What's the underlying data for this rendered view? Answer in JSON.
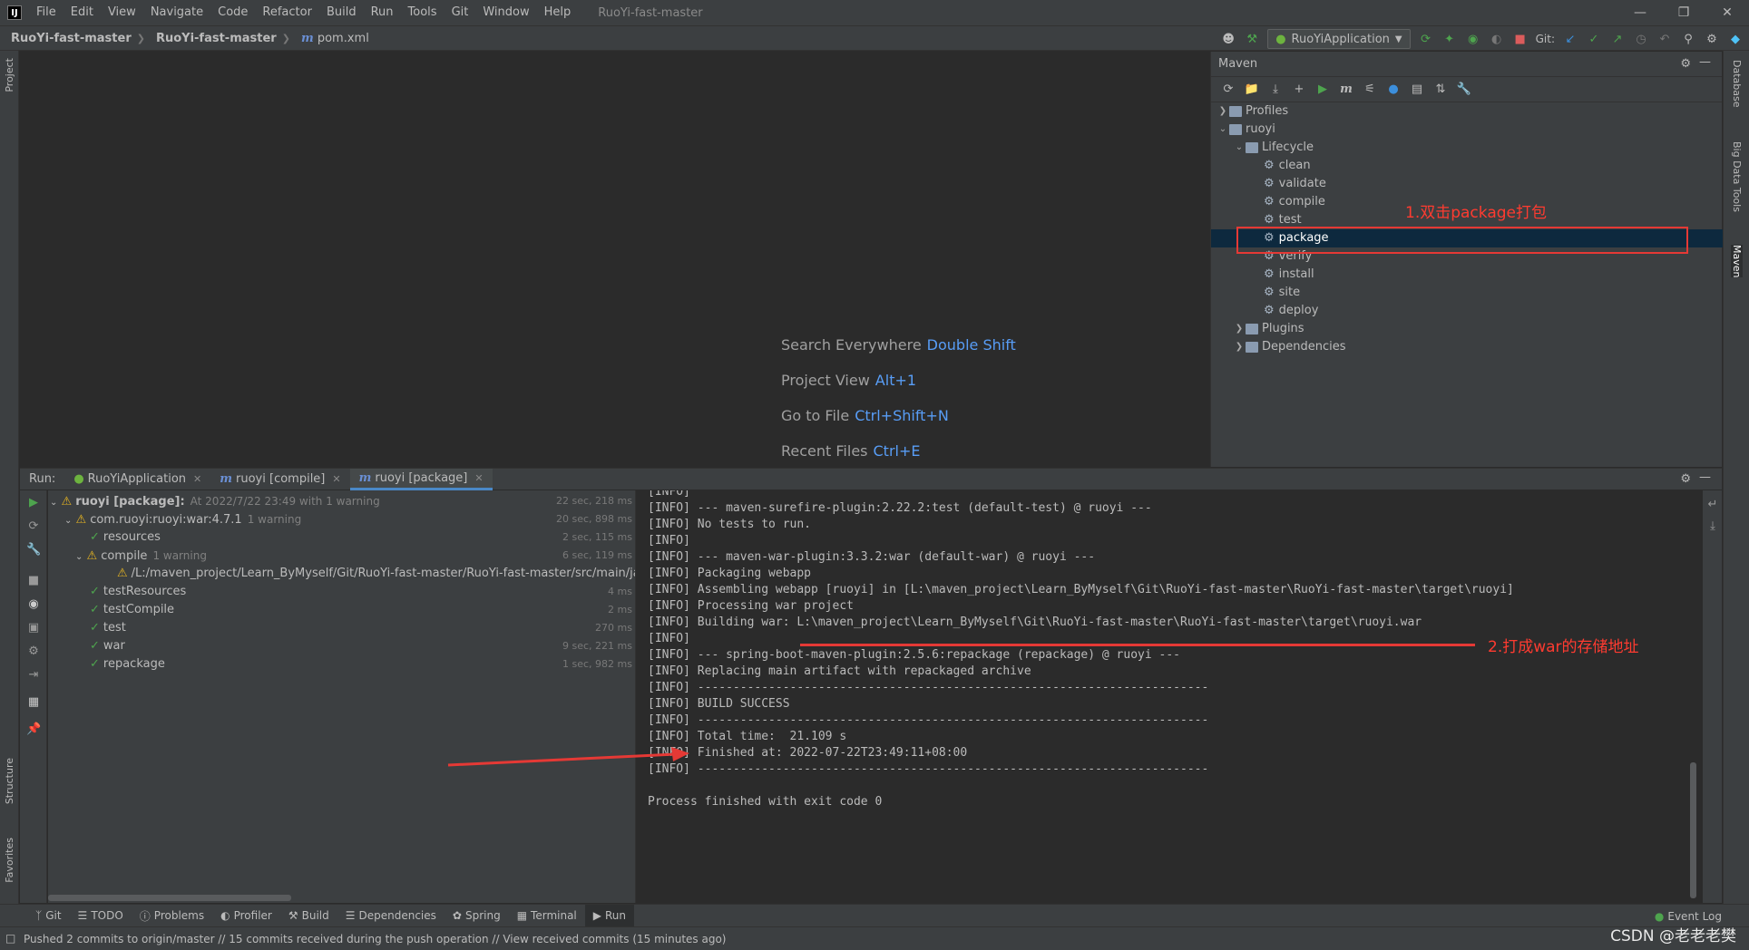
{
  "window": {
    "title": "RuoYi-fast-master",
    "menu": [
      "File",
      "Edit",
      "View",
      "Navigate",
      "Code",
      "Refactor",
      "Build",
      "Run",
      "Tools",
      "Git",
      "Window",
      "Help"
    ]
  },
  "breadcrumb": {
    "project": "RuoYi-fast-master",
    "module": "RuoYi-fast-master",
    "file": "pom.xml"
  },
  "toolbar": {
    "run_config": "RuoYiApplication",
    "git_label": "Git:"
  },
  "left_stripe": {
    "project": "Project",
    "structure": "Structure",
    "favorites": "Favorites"
  },
  "right_stripe": {
    "database": "Database",
    "big_data": "Big Data Tools",
    "maven": "Maven"
  },
  "editor_hints": [
    {
      "label": "Search Everywhere",
      "key": "Double Shift"
    },
    {
      "label": "Project View",
      "key": "Alt+1"
    },
    {
      "label": "Go to File",
      "key": "Ctrl+Shift+N"
    },
    {
      "label": "Recent Files",
      "key": "Ctrl+E"
    }
  ],
  "maven": {
    "title": "Maven",
    "profiles": "Profiles",
    "project": "ruoyi",
    "lifecycle": "Lifecycle",
    "phases": [
      "clean",
      "validate",
      "compile",
      "test",
      "package",
      "verify",
      "install",
      "site",
      "deploy"
    ],
    "plugins": "Plugins",
    "dependencies": "Dependencies",
    "annotation": "1.双击package打包"
  },
  "run": {
    "label": "Run:",
    "tabs": [
      {
        "label": "RuoYiApplication"
      },
      {
        "label": "ruoyi [compile]"
      },
      {
        "label": "ruoyi [package]"
      }
    ],
    "tree": [
      {
        "text": "ruoyi [package]:",
        "extra": "At 2022/7/22 23:49 with 1 warning",
        "time": "22 sec, 218 ms"
      },
      {
        "text": "com.ruoyi:ruoyi:war:4.7.1",
        "extra": "1 warning",
        "time": "20 sec, 898 ms"
      },
      {
        "text": "resources",
        "extra": "",
        "time": "2 sec, 115 ms"
      },
      {
        "text": "compile",
        "extra": "1 warning",
        "time": "6 sec, 119 ms"
      },
      {
        "text": "/L:/maven_project/Learn_ByMyself/Git/RuoYi-fast-master/RuoYi-fast-master/src/main/java/com/",
        "extra": "",
        "time": ""
      },
      {
        "text": "testResources",
        "extra": "",
        "time": "4 ms"
      },
      {
        "text": "testCompile",
        "extra": "",
        "time": "2 ms"
      },
      {
        "text": "test",
        "extra": "",
        "time": "270 ms"
      },
      {
        "text": "war",
        "extra": "",
        "time": "9 sec, 221 ms"
      },
      {
        "text": "repackage",
        "extra": "",
        "time": "1 sec, 982 ms"
      }
    ],
    "console": [
      "[INFO]",
      "[INFO] --- maven-surefire-plugin:2.22.2:test (default-test) @ ruoyi ---",
      "[INFO] No tests to run.",
      "[INFO]",
      "[INFO] --- maven-war-plugin:3.3.2:war (default-war) @ ruoyi ---",
      "[INFO] Packaging webapp",
      "[INFO] Assembling webapp [ruoyi] in [L:\\maven_project\\Learn_ByMyself\\Git\\RuoYi-fast-master\\RuoYi-fast-master\\target\\ruoyi]",
      "[INFO] Processing war project",
      "[INFO] Building war: L:\\maven_project\\Learn_ByMyself\\Git\\RuoYi-fast-master\\RuoYi-fast-master\\target\\ruoyi.war",
      "[INFO]",
      "[INFO] --- spring-boot-maven-plugin:2.5.6:repackage (repackage) @ ruoyi ---",
      "[INFO] Replacing main artifact with repackaged archive",
      "[INFO] ------------------------------------------------------------------------",
      "[INFO] BUILD SUCCESS",
      "[INFO] ------------------------------------------------------------------------",
      "[INFO] Total time:  21.109 s",
      "[INFO] Finished at: 2022-07-22T23:49:11+08:00",
      "[INFO] ------------------------------------------------------------------------",
      "",
      "Process finished with exit code 0"
    ],
    "annotation": "2.打成war的存储地址"
  },
  "bottom_tools": [
    "Git",
    "TODO",
    "Problems",
    "Profiler",
    "Build",
    "Dependencies",
    "Spring",
    "Terminal",
    "Run"
  ],
  "event_log": "Event Log",
  "status": "Pushed 2 commits to origin/master // 15 commits received during the push operation // View received commits (15 minutes ago)",
  "watermark": "CSDN @老老老樊",
  "colors": {
    "accent": "#4a88c7",
    "annotation_red": "#e53935",
    "success_green": "#4ea44e",
    "warning_yellow": "#e6b422"
  }
}
